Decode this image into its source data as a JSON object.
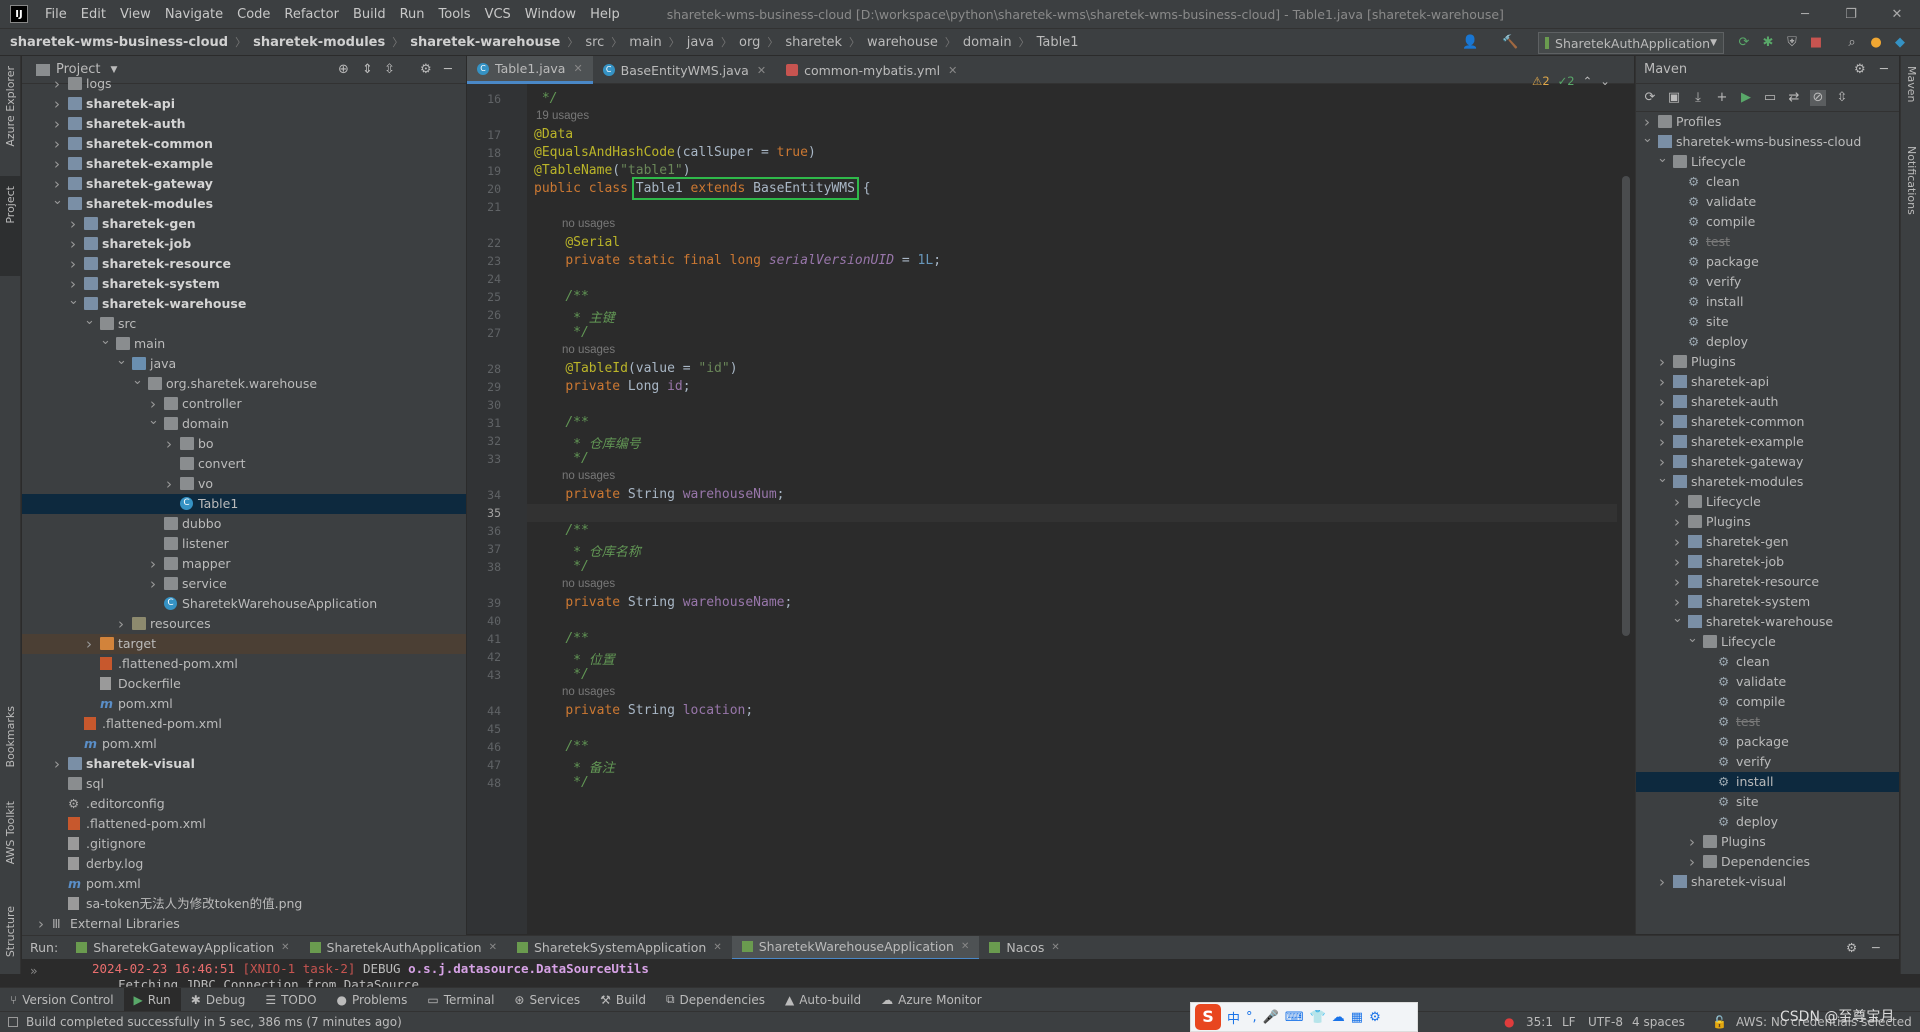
{
  "titlebar": {
    "menus": [
      "File",
      "Edit",
      "View",
      "Navigate",
      "Code",
      "Refactor",
      "Build",
      "Run",
      "Tools",
      "VCS",
      "Window",
      "Help"
    ],
    "title": "sharetek-wms-business-cloud [D:\\workspace\\python\\sharetek-wms\\sharetek-wms-business-cloud] - Table1.java [sharetek-warehouse]"
  },
  "breadcrumbs": [
    "sharetek-wms-business-cloud",
    "sharetek-modules",
    "sharetek-warehouse",
    "src",
    "main",
    "java",
    "org",
    "sharetek",
    "warehouse",
    "domain",
    "Table1"
  ],
  "run_config": "SharetekAuthApplication",
  "left_strip": [
    "Azure Explorer",
    "Project",
    "Bookmarks",
    "AWS Toolkit",
    "Structure"
  ],
  "right_strip": [
    "Maven",
    "Notifications"
  ],
  "project_panel": {
    "title": "Project",
    "rows": [
      {
        "label": "logs",
        "depth": 1,
        "arrow": "right",
        "icon": "folder",
        "bold": false
      },
      {
        "label": "sharetek-api",
        "depth": 1,
        "arrow": "right",
        "icon": "module",
        "bold": true
      },
      {
        "label": "sharetek-auth",
        "depth": 1,
        "arrow": "right",
        "icon": "module",
        "bold": true
      },
      {
        "label": "sharetek-common",
        "depth": 1,
        "arrow": "right",
        "icon": "module",
        "bold": true
      },
      {
        "label": "sharetek-example",
        "depth": 1,
        "arrow": "right",
        "icon": "module",
        "bold": true
      },
      {
        "label": "sharetek-gateway",
        "depth": 1,
        "arrow": "right",
        "icon": "module",
        "bold": true
      },
      {
        "label": "sharetek-modules",
        "depth": 1,
        "arrow": "down",
        "icon": "module",
        "bold": true
      },
      {
        "label": "sharetek-gen",
        "depth": 2,
        "arrow": "right",
        "icon": "module",
        "bold": true
      },
      {
        "label": "sharetek-job",
        "depth": 2,
        "arrow": "right",
        "icon": "module",
        "bold": true
      },
      {
        "label": "sharetek-resource",
        "depth": 2,
        "arrow": "right",
        "icon": "module",
        "bold": true
      },
      {
        "label": "sharetek-system",
        "depth": 2,
        "arrow": "right",
        "icon": "module",
        "bold": true
      },
      {
        "label": "sharetek-warehouse",
        "depth": 2,
        "arrow": "down",
        "icon": "module",
        "bold": true
      },
      {
        "label": "src",
        "depth": 3,
        "arrow": "down",
        "icon": "folder",
        "bold": false
      },
      {
        "label": "main",
        "depth": 4,
        "arrow": "down",
        "icon": "folder",
        "bold": false
      },
      {
        "label": "java",
        "depth": 5,
        "arrow": "down",
        "icon": "src",
        "bold": false
      },
      {
        "label": "org.sharetek.warehouse",
        "depth": 6,
        "arrow": "down",
        "icon": "folder",
        "bold": false
      },
      {
        "label": "controller",
        "depth": 7,
        "arrow": "right",
        "icon": "folder",
        "bold": false
      },
      {
        "label": "domain",
        "depth": 7,
        "arrow": "down",
        "icon": "folder",
        "bold": false
      },
      {
        "label": "bo",
        "depth": 8,
        "arrow": "right",
        "icon": "folder",
        "bold": false
      },
      {
        "label": "convert",
        "depth": 8,
        "arrow": "none",
        "icon": "folder",
        "bold": false
      },
      {
        "label": "vo",
        "depth": 8,
        "arrow": "right",
        "icon": "folder",
        "bold": false
      },
      {
        "label": "Table1",
        "depth": 8,
        "arrow": "none",
        "icon": "class",
        "bold": false,
        "selected": true
      },
      {
        "label": "dubbo",
        "depth": 7,
        "arrow": "none",
        "icon": "folder",
        "bold": false
      },
      {
        "label": "listener",
        "depth": 7,
        "arrow": "none",
        "icon": "folder",
        "bold": false
      },
      {
        "label": "mapper",
        "depth": 7,
        "arrow": "right",
        "icon": "folder",
        "bold": false
      },
      {
        "label": "service",
        "depth": 7,
        "arrow": "right",
        "icon": "folder",
        "bold": false
      },
      {
        "label": "SharetekWarehouseApplication",
        "depth": 7,
        "arrow": "none",
        "icon": "class",
        "bold": false
      },
      {
        "label": "resources",
        "depth": 5,
        "arrow": "right",
        "icon": "res",
        "bold": false
      },
      {
        "label": "target",
        "depth": 3,
        "arrow": "right",
        "icon": "target",
        "bold": false,
        "excluded": true
      },
      {
        "label": ".flattened-pom.xml",
        "depth": 3,
        "arrow": "none",
        "icon": "xml",
        "bold": false
      },
      {
        "label": "Dockerfile",
        "depth": 3,
        "arrow": "none",
        "icon": "file",
        "bold": false
      },
      {
        "label": "pom.xml",
        "depth": 3,
        "arrow": "none",
        "icon": "pom",
        "bold": false
      },
      {
        "label": ".flattened-pom.xml",
        "depth": 2,
        "arrow": "none",
        "icon": "xml",
        "bold": false
      },
      {
        "label": "pom.xml",
        "depth": 2,
        "arrow": "none",
        "icon": "pom",
        "bold": false
      },
      {
        "label": "sharetek-visual",
        "depth": 1,
        "arrow": "right",
        "icon": "module",
        "bold": true
      },
      {
        "label": "sql",
        "depth": 1,
        "arrow": "none",
        "icon": "folder",
        "bold": false
      },
      {
        "label": ".editorconfig",
        "depth": 1,
        "arrow": "none",
        "icon": "cfg",
        "bold": false
      },
      {
        "label": ".flattened-pom.xml",
        "depth": 1,
        "arrow": "none",
        "icon": "xml",
        "bold": false
      },
      {
        "label": ".gitignore",
        "depth": 1,
        "arrow": "none",
        "icon": "file",
        "bold": false
      },
      {
        "label": "derby.log",
        "depth": 1,
        "arrow": "none",
        "icon": "file",
        "bold": false
      },
      {
        "label": "pom.xml",
        "depth": 1,
        "arrow": "none",
        "icon": "pom",
        "bold": false
      },
      {
        "label": "sa-token无法人为修改token的值.png",
        "depth": 1,
        "arrow": "none",
        "icon": "file",
        "bold": false
      },
      {
        "label": "External Libraries",
        "depth": 0,
        "arrow": "right",
        "icon": "lib",
        "bold": false
      }
    ]
  },
  "editor": {
    "tabs": [
      {
        "label": "Table1.java",
        "active": true
      },
      {
        "label": "BaseEntityWMS.java",
        "active": false
      },
      {
        "label": "common-mybatis.yml",
        "active": false
      }
    ],
    "inspections": {
      "warnings": "2",
      "ok": "2"
    },
    "lines": [
      {
        "n": "16",
        "y": 0,
        "html": "<span class='cm'> */</span>"
      },
      {
        "hint": "19 usages",
        "y": 1
      },
      {
        "n": "17",
        "y": 2,
        "html": "<span class='an'>@Data</span>"
      },
      {
        "n": "18",
        "y": 3,
        "html": "<span class='an'>@EqualsAndHashCode</span>(callSuper = <span class='kw'>true</span>)"
      },
      {
        "n": "19",
        "y": 4,
        "html": "<span class='an'>@TableName</span>(<span class='st'>\"table1\"</span>)"
      },
      {
        "n": "20",
        "y": 5,
        "html": "<span class='kw'>public class</span> <span style='outline:2px solid #2fb94a;outline-offset:2px'>Table1 <span class='kw'>extends</span> BaseEntityWMS</span> {"
      },
      {
        "n": "21",
        "y": 6,
        "html": ""
      },
      {
        "hint": "no usages",
        "y": 7,
        "indent": 1
      },
      {
        "n": "22",
        "y": 8,
        "html": "    <span class='an'>@Serial</span>"
      },
      {
        "n": "23",
        "y": 9,
        "html": "    <span class='kw'>private static final long</span> <span class='fi it'>serialVersionUID</span> = <span class='nu'>1L</span>;"
      },
      {
        "n": "24",
        "y": 10,
        "html": ""
      },
      {
        "n": "25",
        "y": 11,
        "html": "    <span class='cm'>/**</span>"
      },
      {
        "n": "26",
        "y": 12,
        "html": "    <span class='cm'> * 主键</span>"
      },
      {
        "n": "27",
        "y": 13,
        "html": "    <span class='cm'> */</span>"
      },
      {
        "hint": "no usages",
        "y": 14,
        "indent": 1
      },
      {
        "n": "28",
        "y": 15,
        "html": "    <span class='an'>@TableId</span>(value = <span class='st'>\"id\"</span>)"
      },
      {
        "n": "29",
        "y": 16,
        "html": "    <span class='kw'>private</span> Long <span class='fi'>id</span>;"
      },
      {
        "n": "30",
        "y": 17,
        "html": ""
      },
      {
        "n": "31",
        "y": 18,
        "html": "    <span class='cm'>/**</span>"
      },
      {
        "n": "32",
        "y": 19,
        "html": "    <span class='cm'> * 仓库编号</span>"
      },
      {
        "n": "33",
        "y": 20,
        "html": "    <span class='cm'> */</span>"
      },
      {
        "hint": "no usages",
        "y": 21,
        "indent": 1
      },
      {
        "n": "34",
        "y": 22,
        "html": "    <span class='kw'>private</span> String <span class='fi'>warehouseNum</span>;"
      },
      {
        "n": "35",
        "y": 23,
        "html": "",
        "current": true
      },
      {
        "n": "36",
        "y": 24,
        "html": "    <span class='cm'>/**</span>"
      },
      {
        "n": "37",
        "y": 25,
        "html": "    <span class='cm'> * 仓库名称</span>"
      },
      {
        "n": "38",
        "y": 26,
        "html": "    <span class='cm'> */</span>"
      },
      {
        "hint": "no usages",
        "y": 27,
        "indent": 1
      },
      {
        "n": "39",
        "y": 28,
        "html": "    <span class='kw'>private</span> String <span class='fi'>warehouseName</span>;"
      },
      {
        "n": "40",
        "y": 29,
        "html": ""
      },
      {
        "n": "41",
        "y": 30,
        "html": "    <span class='cm'>/**</span>"
      },
      {
        "n": "42",
        "y": 31,
        "html": "    <span class='cm'> * 位置</span>"
      },
      {
        "n": "43",
        "y": 32,
        "html": "    <span class='cm'> */</span>"
      },
      {
        "hint": "no usages",
        "y": 33,
        "indent": 1
      },
      {
        "n": "44",
        "y": 34,
        "html": "    <span class='kw'>private</span> String <span class='fi'>location</span>;"
      },
      {
        "n": "45",
        "y": 35,
        "html": ""
      },
      {
        "n": "46",
        "y": 36,
        "html": "    <span class='cm'>/**</span>"
      },
      {
        "n": "47",
        "y": 37,
        "html": "    <span class='cm'> * 备注</span>"
      },
      {
        "n": "48",
        "y": 38,
        "html": "    <span class='cm'> */</span>"
      }
    ]
  },
  "maven": {
    "title": "Maven",
    "rows": [
      {
        "label": "Profiles",
        "depth": 0,
        "arrow": "right",
        "icon": "folder"
      },
      {
        "label": "sharetek-wms-business-cloud",
        "depth": 0,
        "arrow": "down",
        "icon": "mvn"
      },
      {
        "label": "Lifecycle",
        "depth": 1,
        "arrow": "down",
        "icon": "folder"
      },
      {
        "label": "clean",
        "depth": 2,
        "arrow": "none",
        "icon": "gear"
      },
      {
        "label": "validate",
        "depth": 2,
        "arrow": "none",
        "icon": "gear"
      },
      {
        "label": "compile",
        "depth": 2,
        "arrow": "none",
        "icon": "gear"
      },
      {
        "label": "test",
        "depth": 2,
        "arrow": "none",
        "icon": "gear",
        "strike": true
      },
      {
        "label": "package",
        "depth": 2,
        "arrow": "none",
        "icon": "gear"
      },
      {
        "label": "verify",
        "depth": 2,
        "arrow": "none",
        "icon": "gear"
      },
      {
        "label": "install",
        "depth": 2,
        "arrow": "none",
        "icon": "gear"
      },
      {
        "label": "site",
        "depth": 2,
        "arrow": "none",
        "icon": "gear"
      },
      {
        "label": "deploy",
        "depth": 2,
        "arrow": "none",
        "icon": "gear"
      },
      {
        "label": "Plugins",
        "depth": 1,
        "arrow": "right",
        "icon": "folder"
      },
      {
        "label": "sharetek-api",
        "depth": 1,
        "arrow": "right",
        "icon": "mvn"
      },
      {
        "label": "sharetek-auth",
        "depth": 1,
        "arrow": "right",
        "icon": "mvn"
      },
      {
        "label": "sharetek-common",
        "depth": 1,
        "arrow": "right",
        "icon": "mvn"
      },
      {
        "label": "sharetek-example",
        "depth": 1,
        "arrow": "right",
        "icon": "mvn"
      },
      {
        "label": "sharetek-gateway",
        "depth": 1,
        "arrow": "right",
        "icon": "mvn"
      },
      {
        "label": "sharetek-modules",
        "depth": 1,
        "arrow": "down",
        "icon": "mvn"
      },
      {
        "label": "Lifecycle",
        "depth": 2,
        "arrow": "right",
        "icon": "folder"
      },
      {
        "label": "Plugins",
        "depth": 2,
        "arrow": "right",
        "icon": "folder"
      },
      {
        "label": "sharetek-gen",
        "depth": 2,
        "arrow": "right",
        "icon": "mvn"
      },
      {
        "label": "sharetek-job",
        "depth": 2,
        "arrow": "right",
        "icon": "mvn"
      },
      {
        "label": "sharetek-resource",
        "depth": 2,
        "arrow": "right",
        "icon": "mvn"
      },
      {
        "label": "sharetek-system",
        "depth": 2,
        "arrow": "right",
        "icon": "mvn"
      },
      {
        "label": "sharetek-warehouse",
        "depth": 2,
        "arrow": "down",
        "icon": "mvn"
      },
      {
        "label": "Lifecycle",
        "depth": 3,
        "arrow": "down",
        "icon": "folder"
      },
      {
        "label": "clean",
        "depth": 4,
        "arrow": "none",
        "icon": "gear"
      },
      {
        "label": "validate",
        "depth": 4,
        "arrow": "none",
        "icon": "gear"
      },
      {
        "label": "compile",
        "depth": 4,
        "arrow": "none",
        "icon": "gear"
      },
      {
        "label": "test",
        "depth": 4,
        "arrow": "none",
        "icon": "gear",
        "strike": true
      },
      {
        "label": "package",
        "depth": 4,
        "arrow": "none",
        "icon": "gear"
      },
      {
        "label": "verify",
        "depth": 4,
        "arrow": "none",
        "icon": "gear"
      },
      {
        "label": "install",
        "depth": 4,
        "arrow": "none",
        "icon": "gear",
        "selected": true
      },
      {
        "label": "site",
        "depth": 4,
        "arrow": "none",
        "icon": "gear"
      },
      {
        "label": "deploy",
        "depth": 4,
        "arrow": "none",
        "icon": "gear"
      },
      {
        "label": "Plugins",
        "depth": 3,
        "arrow": "right",
        "icon": "folder"
      },
      {
        "label": "Dependencies",
        "depth": 3,
        "arrow": "right",
        "icon": "folder"
      },
      {
        "label": "sharetek-visual",
        "depth": 1,
        "arrow": "right",
        "icon": "mvn"
      }
    ]
  },
  "run": {
    "label": "Run:",
    "tabs": [
      {
        "label": "SharetekGatewayApplication",
        "active": false
      },
      {
        "label": "SharetekAuthApplication",
        "active": false
      },
      {
        "label": "SharetekSystemApplication",
        "active": false
      },
      {
        "label": "SharetekWarehouseApplication",
        "active": true
      },
      {
        "label": "Nacos",
        "active": false
      }
    ],
    "console_line": {
      "time": "2024-02-23 16:46:51",
      "thread": "[XNIO-1 task-2]",
      "level": "DEBUG",
      "logger": "o.s.j.datasource.DataSourceUtils"
    },
    "console_line2": "Fetching JDBC Connection from DataSource"
  },
  "toolwindows": [
    "Version Control",
    "Run",
    "Debug",
    "TODO",
    "Problems",
    "Terminal",
    "Services",
    "Build",
    "Dependencies",
    "Auto-build",
    "Azure Monitor"
  ],
  "status": {
    "message": "Build completed successfully in 5 sec, 386 ms (7 minutes ago)",
    "position": "35:1",
    "line_sep": "LF",
    "encoding": "UTF-8",
    "indent": "4 spaces",
    "aws": "AWS: No credentials selected",
    "watermark": "CSDN @至尊宝月"
  },
  "ime": {
    "labels": [
      "中",
      "°,",
      "🎤",
      "⌨",
      "👕",
      "☁",
      "▦",
      "⚙"
    ]
  }
}
